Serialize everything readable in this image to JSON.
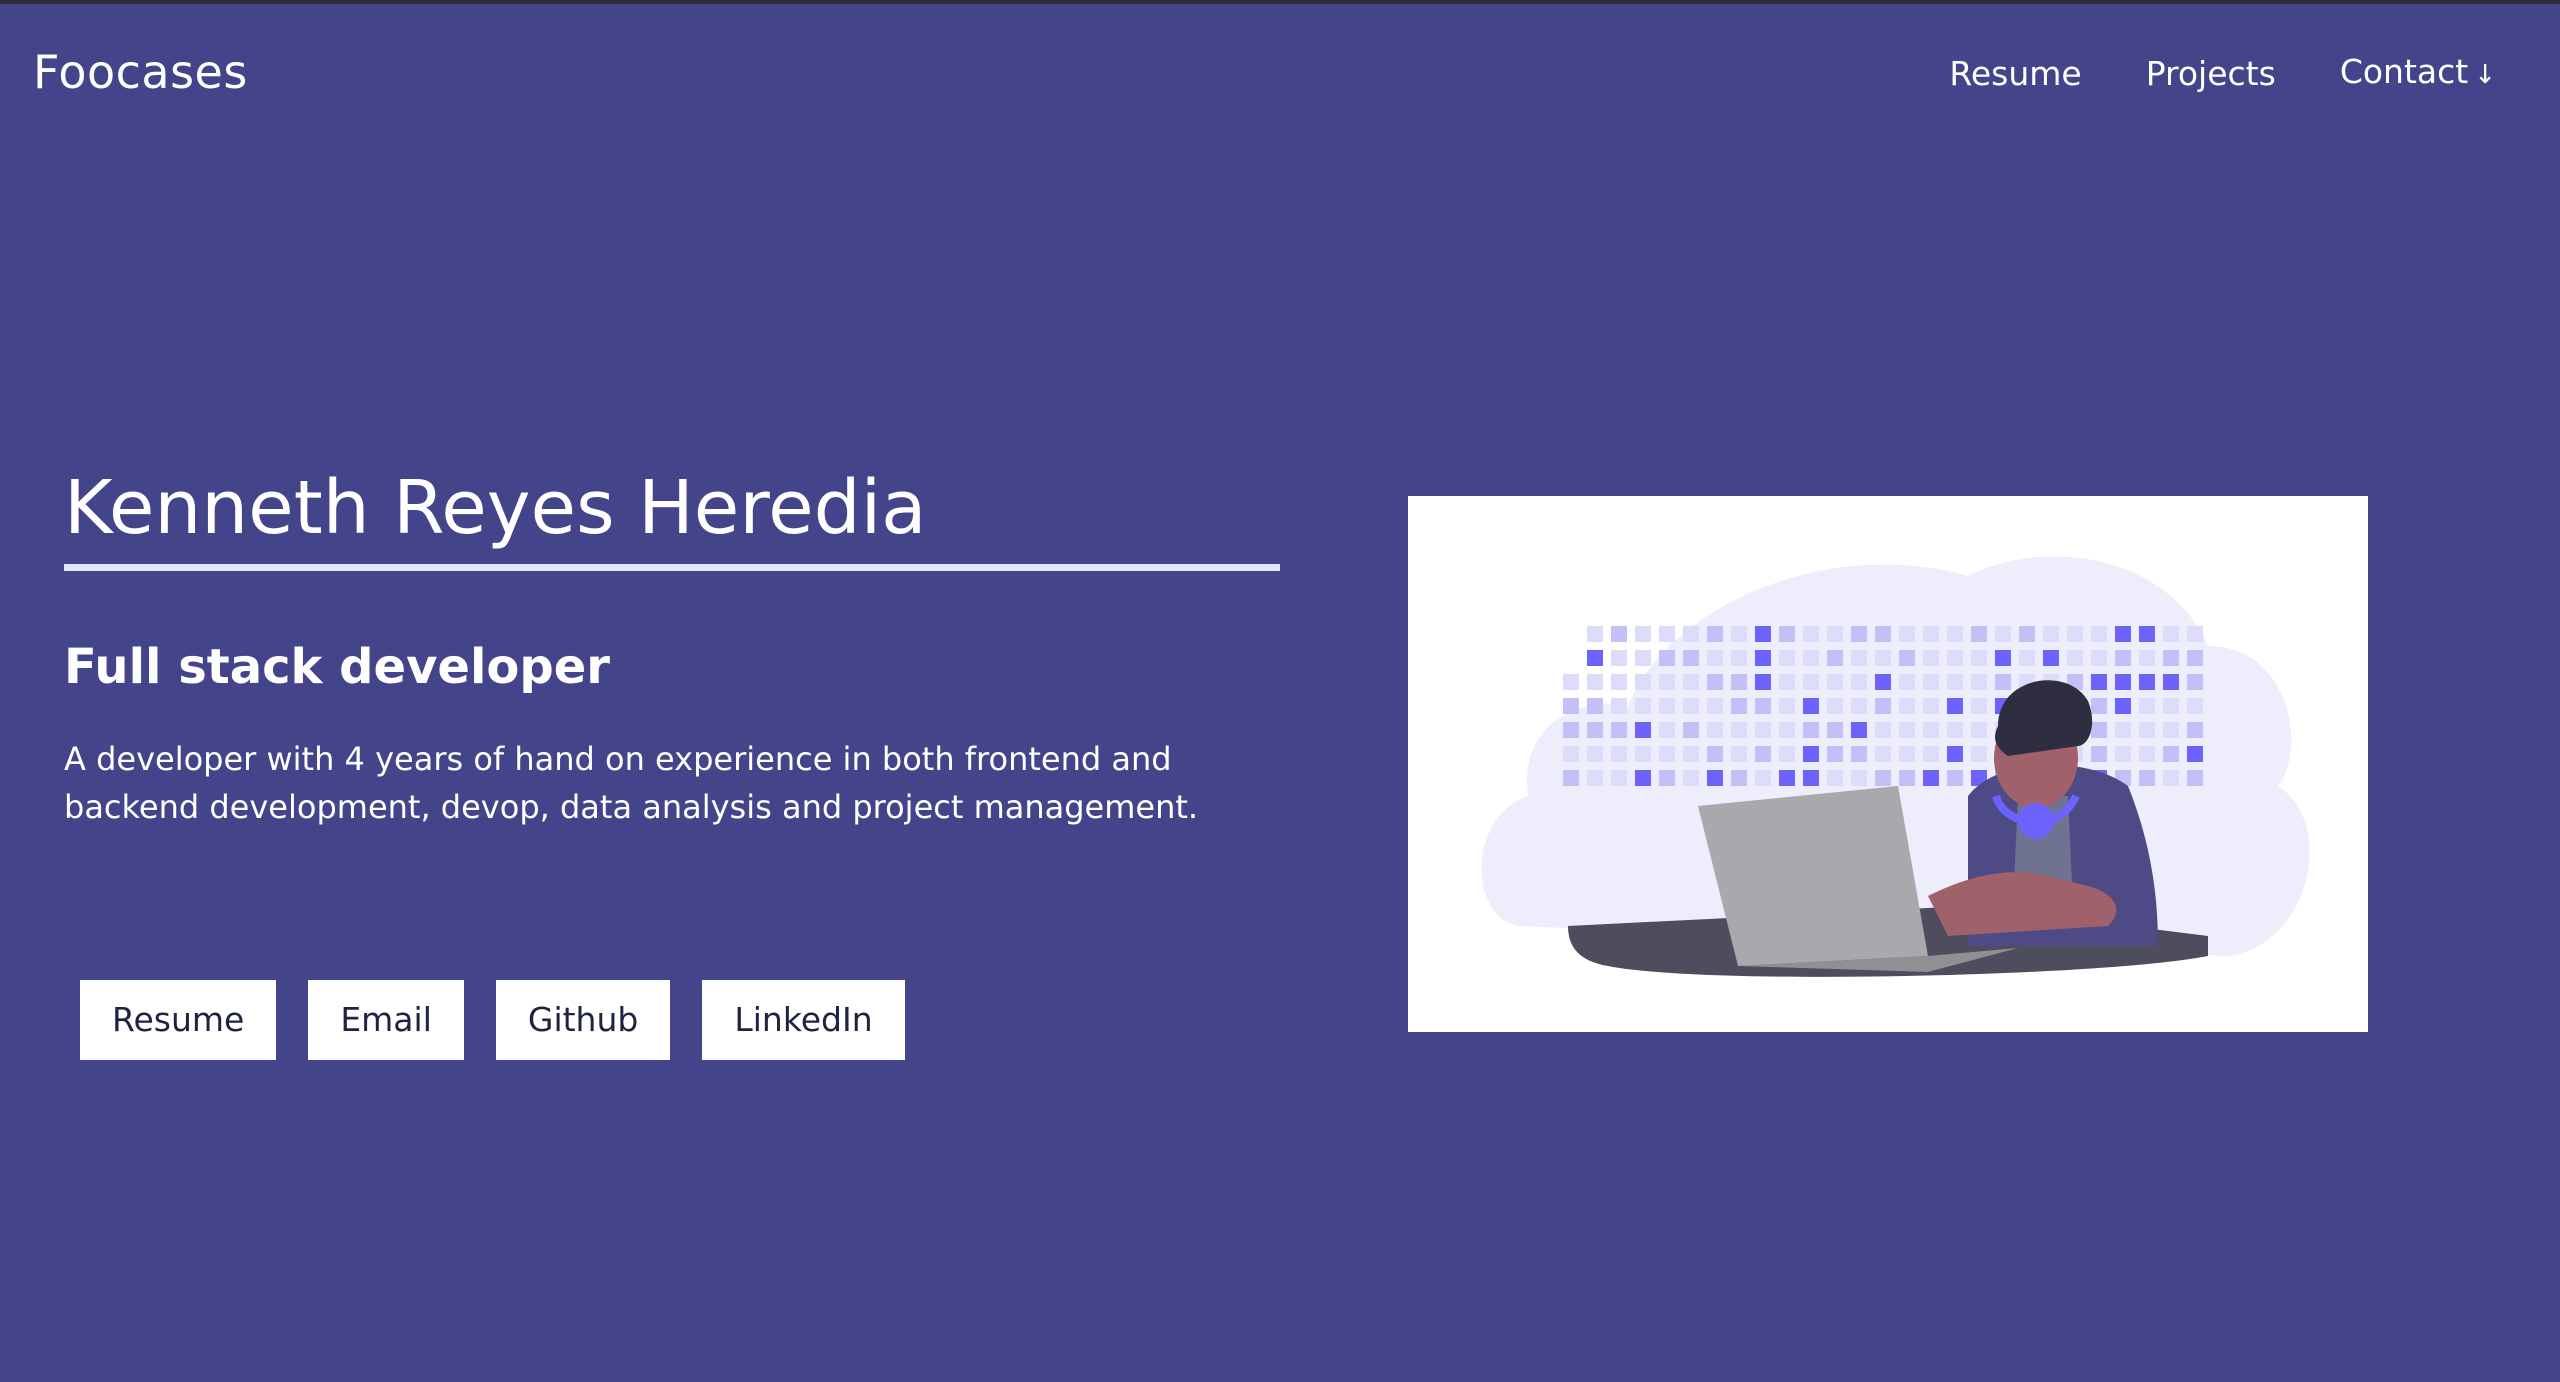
{
  "brand": "Foocases",
  "nav": {
    "resume": "Resume",
    "projects": "Projects",
    "contact": "Contact",
    "contact_arrow": "↓"
  },
  "hero": {
    "name": "Kenneth Reyes Heredia",
    "role": "Full stack developer",
    "description": "A developer with 4 years of hand on experience in both frontend and backend development, devop, data analysis and project management."
  },
  "buttons": {
    "resume": "Resume",
    "email": "Email",
    "github": "Github",
    "linkedin": "LinkedIn"
  },
  "illustration": {
    "icon": "developer-at-laptop-illustration"
  },
  "colors": {
    "background": "#44448b",
    "accent": "#6c63ff",
    "button_text": "#1f2240"
  }
}
